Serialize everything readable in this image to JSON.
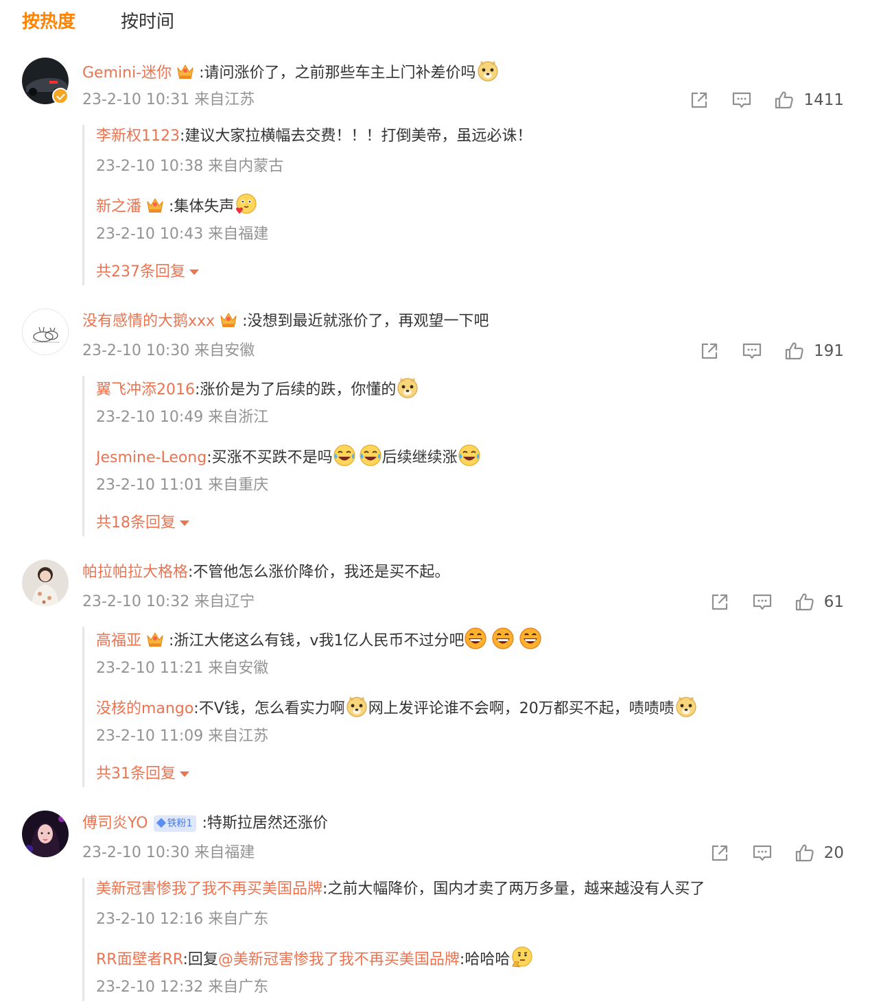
{
  "tabs": {
    "hot": "按热度",
    "time": "按时间"
  },
  "icons": {
    "share": "share-icon",
    "comment": "comment-icon",
    "like": "like-icon",
    "crown": "crown-badge-icon",
    "verified": "verified-badge-icon",
    "emoji_doge": "doge-emoji",
    "emoji_laugh_cry": "laugh-cry-emoji",
    "emoji_grin": "grin-emoji",
    "emoji_shy": "shy-emoji",
    "emoji_think": "think-emoji"
  },
  "colors": {
    "accent": "#ff8200",
    "username": "#eb7350",
    "meta": "#939393"
  },
  "comments": [
    {
      "user": "Gemini-迷你",
      "text": ":请问涨价了，之前那些车主上门补差价吗",
      "meta": "23-2-10 10:31 来自江苏",
      "likes": "1411",
      "replies": [
        {
          "user": "李新权1123",
          "text": ":建议大家拉横幅去交费！！！打倒美帝，虽远必诛！",
          "meta": "23-2-10 10:38 来自内蒙古"
        },
        {
          "user": "新之潘",
          "text": ":集体失声",
          "meta": "23-2-10 10:43 来自福建"
        }
      ],
      "more": "共237条回复"
    },
    {
      "user": "没有感情的大鹅xxx",
      "text": ":没想到最近就涨价了，再观望一下吧",
      "meta": "23-2-10 10:30 来自安徽",
      "likes": "191",
      "replies": [
        {
          "user": "翼飞冲添2016",
          "text": ":涨价是为了后续的跌，你懂的",
          "meta": "23-2-10 10:49 来自浙江"
        },
        {
          "user": "Jesmine-Leong",
          "text": ":买涨不买跌不是吗",
          "text2": "后续继续涨",
          "meta": "23-2-10 11:01 来自重庆"
        }
      ],
      "more": "共18条回复"
    },
    {
      "user": "帕拉帕拉大格格",
      "text": ":不管他怎么涨价降价，我还是买不起。",
      "meta": "23-2-10 10:32 来自辽宁",
      "likes": "61",
      "replies": [
        {
          "user": "高福亚",
          "text": ":浙江大佬这么有钱，v我1亿人民币不过分吧",
          "meta": "23-2-10 11:21 来自安徽"
        },
        {
          "user": "没核的mango",
          "text": ":不V钱，怎么看实力啊",
          "text2": "网上发评论谁不会啊，20万都买不起，啧啧啧",
          "meta": "23-2-10 11:09 来自江苏"
        }
      ],
      "more": "共31条回复"
    },
    {
      "user": "傅司炎YO",
      "badge": "铁粉1",
      "text": ":特斯拉居然还涨价",
      "meta": "23-2-10 10:30 来自福建",
      "likes": "20",
      "replies": [
        {
          "user": "美新冠害惨我了我不再买美国品牌",
          "text": ":之前大幅降价，国内才卖了两万多量，越来越没有人买了",
          "meta": "23-2-10 12:16 来自广东"
        },
        {
          "user": "RR面壁者RR",
          "text": ":回复",
          "mention": "@美新冠害惨我了我不再买美国品牌",
          "text2": ":哈哈哈",
          "meta": "23-2-10 12:32 来自广东"
        }
      ]
    }
  ]
}
